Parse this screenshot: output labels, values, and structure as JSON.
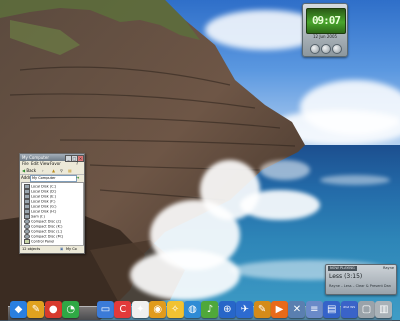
{
  "clock_widget": {
    "time": "09:07",
    "date": "12 Jun 2005"
  },
  "my_computer": {
    "title": "My Computer",
    "menu": [
      "File",
      "Edit",
      "View",
      "Favor",
      "?"
    ],
    "toolbar": {
      "back": "Back",
      "forward": "›"
    },
    "address_label": "Address",
    "address_value": "My Computer",
    "drives": [
      "Local Disk (C:)",
      "Local Disk (D:)",
      "Local Disk (E:)",
      "Local Disk (F:)",
      "Local Disk (G:)",
      "Local Disk (H:)",
      "Sam (I:)",
      "Compact Disc (J:)",
      "Compact Disc (K:)",
      "Compact Disc (L:)",
      "Compact Disc (M:)",
      "Control Panel"
    ],
    "status_left": "12 objects",
    "status_right": "My Co"
  },
  "media_widget": {
    "badge": "NOW PLAYING",
    "extra": "Rayne",
    "title": "Less (3:15)",
    "info": "Rayne – Less – Clear & Present Danger"
  },
  "dock": {
    "items": [
      {
        "name": "finder-icon",
        "bg": "#2a7fe0",
        "glyph": "◆"
      },
      {
        "name": "pen-tool-icon",
        "bg": "#e0a21f",
        "glyph": "✎"
      },
      {
        "name": "fire-icon",
        "bg": "#d83a2c",
        "glyph": "●"
      },
      {
        "name": "clock-icon",
        "bg": "#2fa845",
        "glyph": "◔"
      },
      {
        "name": "blank-icon",
        "bg": "transparent",
        "glyph": ""
      },
      {
        "name": "monitor-icon",
        "bg": "#3b7bd8",
        "glyph": "▭"
      },
      {
        "name": "red-c-icon",
        "bg": "#e23a3a",
        "glyph": "C"
      },
      {
        "name": "rocket-icon",
        "bg": "#f0f0f0",
        "glyph": "✦"
      },
      {
        "name": "burn-cd-icon",
        "bg": "#e09b1c",
        "glyph": "◉"
      },
      {
        "name": "runner-icon",
        "bg": "#f1c232",
        "glyph": "✧"
      },
      {
        "name": "globe-icon",
        "bg": "#2f8bd5",
        "glyph": "◍"
      },
      {
        "name": "music-icon",
        "bg": "#4fa83a",
        "glyph": "♪"
      },
      {
        "name": "world-icon",
        "bg": "#2766c8",
        "glyph": "⊕"
      },
      {
        "name": "satellite-icon",
        "bg": "#2d6bd0",
        "glyph": "✈"
      },
      {
        "name": "pencil-icon",
        "bg": "#d48b1a",
        "glyph": "✎"
      },
      {
        "name": "media-icon",
        "bg": "#e86a1a",
        "glyph": "▶"
      },
      {
        "name": "tools-icon",
        "bg": "#5a7fb0",
        "glyph": "✕"
      },
      {
        "name": "notes-icon",
        "bg": "#6a8ac8",
        "glyph": "≡"
      },
      {
        "name": "storage-icon",
        "bg": "#3563c9",
        "glyph": "▤"
      },
      {
        "name": "ipod-icon",
        "bg": "#3a63c8",
        "glyph": "",
        "label": "iPod WS"
      },
      {
        "name": "disk-icon",
        "bg": "#9aa3aa",
        "glyph": "▢"
      },
      {
        "name": "trash-icon",
        "bg": "#aab2b8",
        "glyph": "▥"
      }
    ]
  }
}
